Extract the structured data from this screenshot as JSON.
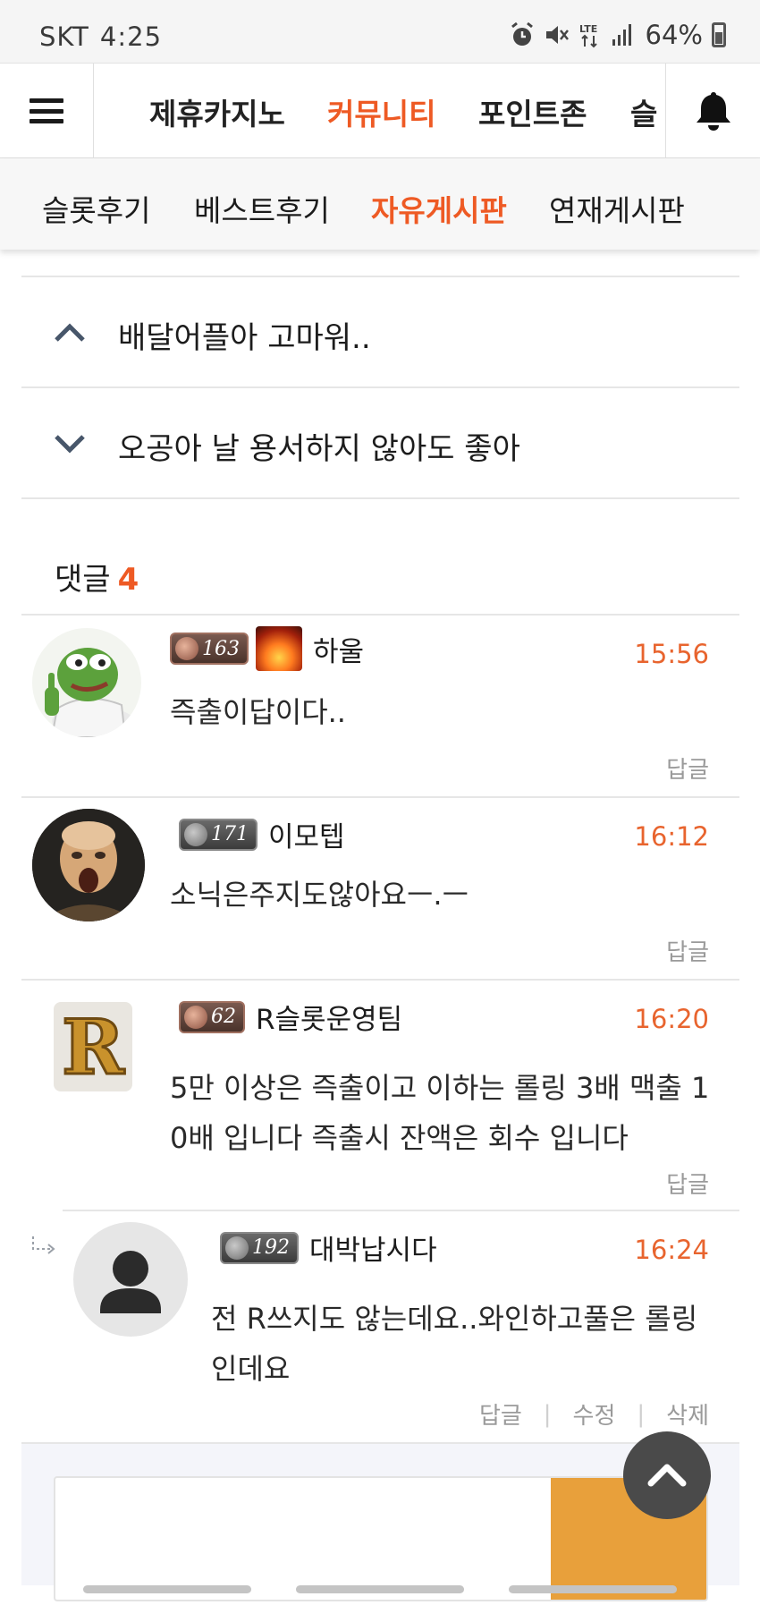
{
  "status_bar": {
    "carrier": "SKT",
    "time": "4:25",
    "battery": "64%",
    "network": "LTE"
  },
  "top_nav": {
    "menu_icon": "hamburger-icon",
    "tabs": [
      {
        "label": "제휴카지노",
        "active": false
      },
      {
        "label": "커뮤니티",
        "active": true
      },
      {
        "label": "포인트존",
        "active": false
      },
      {
        "label": "슬",
        "active": false
      }
    ],
    "bell_icon": "bell-icon"
  },
  "sub_nav": {
    "tabs": [
      {
        "label": "슬롯후기",
        "active": false
      },
      {
        "label": "베스트후기",
        "active": false
      },
      {
        "label": "자유게시판",
        "active": true
      },
      {
        "label": "연재게시판",
        "active": false
      }
    ]
  },
  "post_nav": {
    "prev_title": "배달어플아 고마워..",
    "next_title": "오공아 날 용서하지 않아도 좋아"
  },
  "comments_header": {
    "label": "댓글",
    "count": "4"
  },
  "comments": [
    {
      "level": "163",
      "nickname": "하울",
      "time": "15:56",
      "text": "즉출이답이다..",
      "reply_label": "답글"
    },
    {
      "level": "171",
      "nickname": "이모텝",
      "time": "16:12",
      "text": "소닉은주지도않아요ㅡ.ㅡ",
      "reply_label": "답글"
    },
    {
      "level": "62",
      "nickname": "R슬롯운영팀",
      "time": "16:20",
      "text_line1": "5만 이상은 즉출이고 이하는 롤링 3배 맥출 1",
      "text_line2": "0배 입니다 즉출시 잔액은 회수 입니다",
      "reply_label": "답글"
    },
    {
      "level": "192",
      "nickname": "대박납시다",
      "time": "16:24",
      "text_line1": "전 R쓰지도 않는데요..와인하고풀은 롤링",
      "text_line2": "인데요",
      "reply_label": "답글",
      "edit_label": "수정",
      "delete_label": "삭제"
    }
  ],
  "colors": {
    "accent": "#ee5a24",
    "time": "#e8642e",
    "muted": "#9a9a9a"
  }
}
